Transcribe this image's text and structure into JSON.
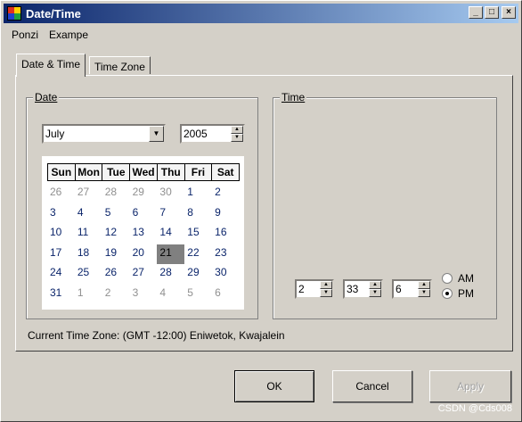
{
  "window": {
    "title": "Date/Time",
    "caption_buttons": {
      "minimize": "_",
      "maximize": "□",
      "close": "×"
    }
  },
  "menu": [
    "Ponzi",
    "Exampe"
  ],
  "tabs": [
    {
      "label": "Date & Time",
      "active": true
    },
    {
      "label": "Time Zone",
      "active": false
    }
  ],
  "date_group": {
    "label": "Date",
    "month": "July",
    "year": "2005",
    "calendar": {
      "weekdays": [
        "Sun",
        "Mon",
        "Tue",
        "Wed",
        "Thu",
        "Fri",
        "Sat"
      ],
      "days": [
        {
          "d": "26",
          "t": "other"
        },
        {
          "d": "27",
          "t": "other"
        },
        {
          "d": "28",
          "t": "other"
        },
        {
          "d": "29",
          "t": "other"
        },
        {
          "d": "30",
          "t": "other"
        },
        {
          "d": "1",
          "t": "cur"
        },
        {
          "d": "2",
          "t": "cur"
        },
        {
          "d": "3",
          "t": "cur"
        },
        {
          "d": "4",
          "t": "cur"
        },
        {
          "d": "5",
          "t": "cur"
        },
        {
          "d": "6",
          "t": "cur"
        },
        {
          "d": "7",
          "t": "cur"
        },
        {
          "d": "8",
          "t": "cur"
        },
        {
          "d": "9",
          "t": "cur"
        },
        {
          "d": "10",
          "t": "cur"
        },
        {
          "d": "11",
          "t": "cur"
        },
        {
          "d": "12",
          "t": "cur"
        },
        {
          "d": "13",
          "t": "cur"
        },
        {
          "d": "14",
          "t": "cur"
        },
        {
          "d": "15",
          "t": "cur"
        },
        {
          "d": "16",
          "t": "cur"
        },
        {
          "d": "17",
          "t": "cur"
        },
        {
          "d": "18",
          "t": "cur"
        },
        {
          "d": "19",
          "t": "cur"
        },
        {
          "d": "20",
          "t": "cur"
        },
        {
          "d": "21",
          "t": "sel"
        },
        {
          "d": "22",
          "t": "cur"
        },
        {
          "d": "23",
          "t": "cur"
        },
        {
          "d": "24",
          "t": "cur"
        },
        {
          "d": "25",
          "t": "cur"
        },
        {
          "d": "26",
          "t": "cur"
        },
        {
          "d": "27",
          "t": "cur"
        },
        {
          "d": "28",
          "t": "cur"
        },
        {
          "d": "29",
          "t": "cur"
        },
        {
          "d": "30",
          "t": "cur"
        },
        {
          "d": "31",
          "t": "cur"
        },
        {
          "d": "1",
          "t": "other"
        },
        {
          "d": "2",
          "t": "other"
        },
        {
          "d": "3",
          "t": "other"
        },
        {
          "d": "4",
          "t": "other"
        },
        {
          "d": "5",
          "t": "other"
        },
        {
          "d": "6",
          "t": "other"
        }
      ]
    }
  },
  "time_group": {
    "label": "Time",
    "hour": "2",
    "minute": "33",
    "second": "6",
    "am_label": "AM",
    "pm_label": "PM",
    "selected": "PM"
  },
  "timezone_text": "Current Time Zone: (GMT -12:00) Eniwetok, Kwajalein",
  "buttons": {
    "ok": "OK",
    "cancel": "Cancel",
    "apply": "Apply"
  },
  "watermark": "CSDN @Cds008",
  "colors": {
    "title_start": "#0a246a",
    "title_end": "#a6caf0",
    "face": "#d4d0c8",
    "calendar_day": "#0a246a",
    "calendar_other": "#909090",
    "selected_day": "#808080"
  }
}
